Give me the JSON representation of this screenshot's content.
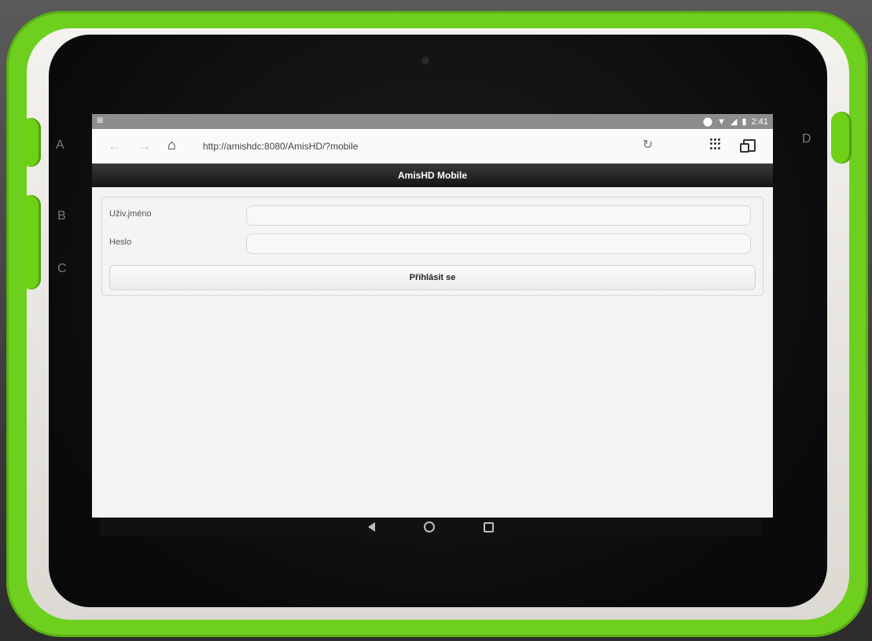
{
  "device": {
    "side_letters": [
      "A",
      "B",
      "C",
      "D"
    ]
  },
  "status_bar": {
    "time": "2:41",
    "icons": [
      "location-icon",
      "wifi-icon",
      "signal-icon",
      "battery-icon"
    ]
  },
  "browser": {
    "url": "http://amishdc:8080/AmisHD/?mobile"
  },
  "app": {
    "header_title": "AmisHD Mobile",
    "username_label": "Uživ.jméno",
    "password_label": "Heslo",
    "login_button": "Přihlásit se"
  }
}
